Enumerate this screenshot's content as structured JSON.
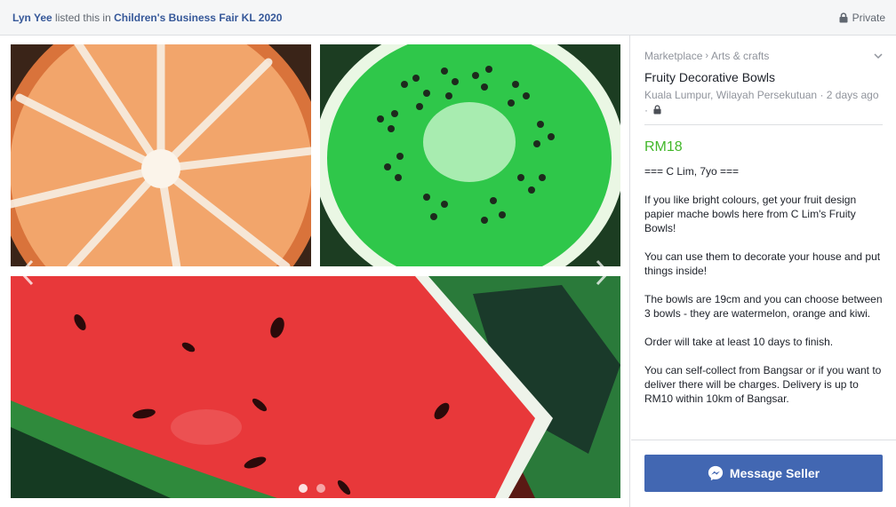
{
  "header": {
    "poster_name": "Lyn Yee",
    "action_text": "listed this in",
    "group_name": "Children's Business Fair KL 2020",
    "privacy_label": "Private",
    "privacy_icon": "lock-icon"
  },
  "gallery": {
    "photos": [
      "orange-bowl",
      "kiwi-bowl",
      "watermelon-bowl"
    ],
    "prev_icon": "chevron-left-icon",
    "next_icon": "chevron-right-icon",
    "page_count": 2,
    "active_page": 1
  },
  "listing": {
    "breadcrumb": [
      "Marketplace",
      "Arts & crafts"
    ],
    "breadcrumb_separator": "›",
    "title": "Fruity Decorative Bowls",
    "location": "Kuala Lumpur, Wilayah Persekutuan",
    "posted": "2 days ago",
    "meta_separator": "·",
    "price": "RM18",
    "description": [
      "=== C Lim, 7yo ===",
      "If you like bright colours, get your fruit design papier mache bowls here from C Lim's Fruity Bowls!",
      "You can use them to decorate your house and put things inside!",
      "The bowls are 19cm and you can choose between 3 bowls - they are watermelon, orange and kiwi.",
      "Order will take at least 10 days to finish.",
      "You can self-collect from Bangsar or if you want to deliver there will be charges. Delivery is up to RM10 within 10km of Bangsar."
    ]
  },
  "actions": {
    "message_label": "Message Seller",
    "message_icon": "messenger-icon"
  },
  "colors": {
    "link": "#365899",
    "price": "#42b72a",
    "button": "#4267b2",
    "muted": "#90949c"
  }
}
